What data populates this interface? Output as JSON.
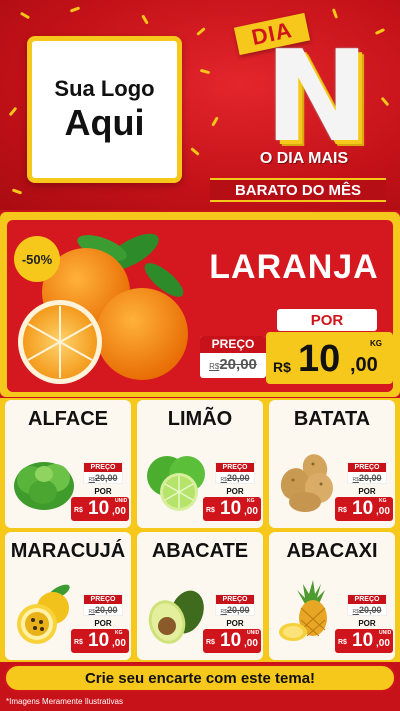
{
  "header": {
    "logo_line1": "Sua Logo",
    "logo_line2": "Aqui",
    "dia": "DIA",
    "big_letter": "N",
    "slogan_line1": "O DIA MAIS",
    "slogan_line2": "BARATO DO MÊS"
  },
  "featured": {
    "discount": "-50%",
    "name": "LARANJA",
    "por": "POR",
    "preco_label": "PREÇO",
    "old_currency": "R$",
    "old_price": "20,00",
    "currency": "R$",
    "price_int": "10",
    "price_dec": ",00",
    "unit": "KG"
  },
  "products": [
    {
      "name": "ALFACE",
      "preco_label": "PREÇO",
      "old_currency": "R$",
      "old_price": "20,00",
      "por": "POR",
      "currency": "R$",
      "price_int": "10",
      "price_dec": ",00",
      "unit": "UNID",
      "icon": "lettuce-icon"
    },
    {
      "name": "LIMÃO",
      "preco_label": "PREÇO",
      "old_currency": "R$",
      "old_price": "20,00",
      "por": "POR",
      "currency": "R$",
      "price_int": "10",
      "price_dec": ",00",
      "unit": "KG",
      "icon": "lime-icon"
    },
    {
      "name": "BATATA",
      "preco_label": "PREÇO",
      "old_currency": "R$",
      "old_price": "20,00",
      "por": "POR",
      "currency": "R$",
      "price_int": "10",
      "price_dec": ",00",
      "unit": "KG",
      "icon": "potato-icon"
    },
    {
      "name": "MARACUJÁ",
      "preco_label": "PREÇO",
      "old_currency": "R$",
      "old_price": "20,00",
      "por": "POR",
      "currency": "R$",
      "price_int": "10",
      "price_dec": ",00",
      "unit": "KG",
      "icon": "passion-fruit-icon"
    },
    {
      "name": "ABACATE",
      "preco_label": "PREÇO",
      "old_currency": "R$",
      "old_price": "20,00",
      "por": "POR",
      "currency": "R$",
      "price_int": "10",
      "price_dec": ",00",
      "unit": "UNID",
      "icon": "avocado-icon"
    },
    {
      "name": "ABACAXI",
      "preco_label": "PREÇO",
      "old_currency": "R$",
      "old_price": "20,00",
      "por": "POR",
      "currency": "R$",
      "price_int": "10",
      "price_dec": ",00",
      "unit": "UNID",
      "icon": "pineapple-icon"
    }
  ],
  "footer": {
    "cta": "Crie seu encarte com este tema!",
    "disclaimer": "*Imagens Meramente Ilustrativas"
  },
  "colors": {
    "red": "#c8121a",
    "yellow": "#f7c81c",
    "card": "#fdf8ef"
  }
}
